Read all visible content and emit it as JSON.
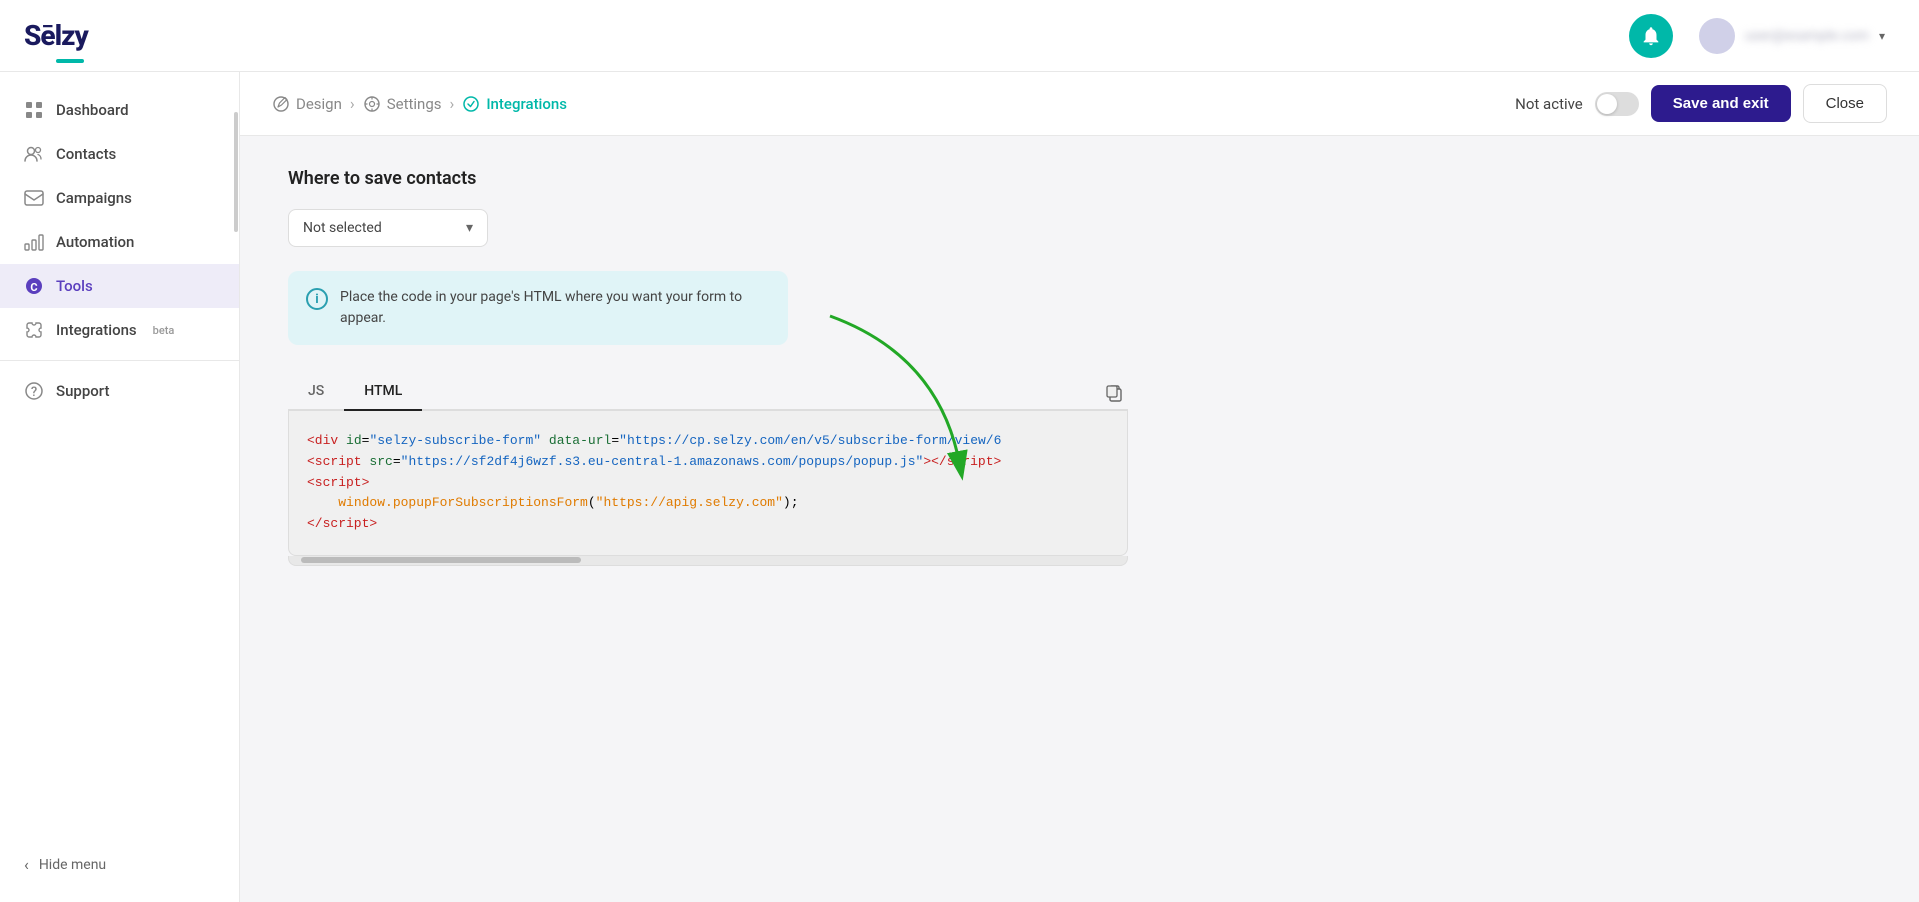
{
  "topbar": {
    "logo_text": "Sēlzy",
    "notification_icon": "bell",
    "user_name": "user@example.com",
    "chevron": "▾"
  },
  "sidebar": {
    "items": [
      {
        "id": "dashboard",
        "label": "Dashboard",
        "icon": "grid"
      },
      {
        "id": "contacts",
        "label": "Contacts",
        "icon": "users"
      },
      {
        "id": "campaigns",
        "label": "Campaigns",
        "icon": "mail"
      },
      {
        "id": "automation",
        "label": "Automation",
        "icon": "bar-chart"
      },
      {
        "id": "tools",
        "label": "Tools",
        "icon": "c-logo",
        "active": true
      },
      {
        "id": "integrations",
        "label": "Integrations",
        "icon": "puzzle",
        "badge": "beta"
      }
    ],
    "support_label": "Support",
    "hide_menu_label": "Hide menu"
  },
  "breadcrumb": {
    "design_label": "Design",
    "settings_label": "Settings",
    "integrations_label": "Integrations"
  },
  "header_actions": {
    "not_active_label": "Not active",
    "save_button_label": "Save and exit",
    "close_button_label": "Close"
  },
  "main": {
    "section_title": "Where to save contacts",
    "dropdown_value": "Not selected",
    "info_text": "Place the code in your page's HTML where you want your form to appear.",
    "tabs": [
      {
        "id": "js",
        "label": "JS",
        "active": false
      },
      {
        "id": "html",
        "label": "HTML",
        "active": true
      }
    ],
    "code_lines": [
      "<div id=\"selzy-subscribe-form\" data-url=\"https://cp.selzy.com/en/v5/subscribe-form/view/6",
      "<script src=\"https://sf2df4j6wzf.s3.eu-central-1.amazonaws.com/popups/popup.js\"><\\/script>",
      "<script>",
      "    window.popupForSubscriptionsForm(\"https://apig.selzy.com\");",
      "<\\/script>"
    ]
  }
}
